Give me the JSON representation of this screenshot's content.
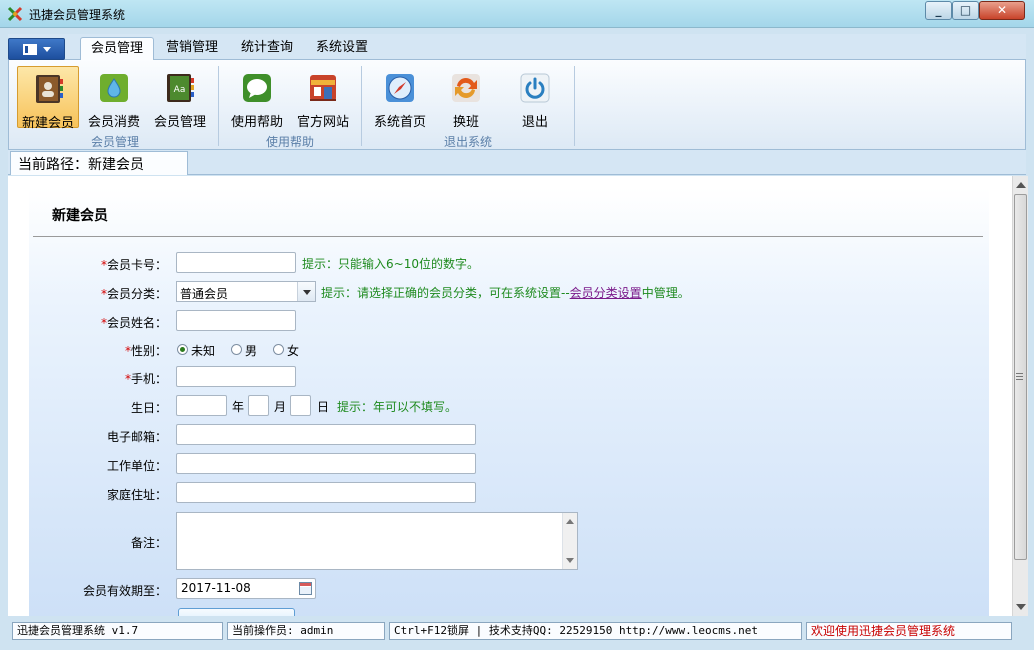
{
  "window": {
    "title": "迅捷会员管理系统"
  },
  "tabs": [
    {
      "label": "会员管理",
      "active": true
    },
    {
      "label": "营销管理",
      "active": false
    },
    {
      "label": "统计查询",
      "active": false
    },
    {
      "label": "系统设置",
      "active": false
    }
  ],
  "ribbon": {
    "groups": [
      {
        "label": "会员管理",
        "buttons": [
          {
            "label": "新建会员",
            "icon": "address-book-icon",
            "active": true
          },
          {
            "label": "会员消费",
            "icon": "water-drop-icon",
            "active": false
          },
          {
            "label": "会员管理",
            "icon": "book-icon",
            "active": false
          }
        ]
      },
      {
        "label": "使用帮助",
        "buttons": [
          {
            "label": "使用帮助",
            "icon": "chat-bubble-icon",
            "active": false
          },
          {
            "label": "官方网站",
            "icon": "storefront-icon",
            "active": false
          }
        ]
      },
      {
        "label": "退出系统",
        "buttons": [
          {
            "label": "系统首页",
            "icon": "compass-icon",
            "active": false
          },
          {
            "label": "换班",
            "icon": "swap-icon",
            "active": false
          },
          {
            "label": "退出",
            "icon": "power-icon",
            "active": false
          }
        ]
      }
    ]
  },
  "breadcrumb": {
    "text": "当前路径：新建会员"
  },
  "form": {
    "title": "新建会员",
    "card_no": {
      "label": "会员卡号：",
      "required": true,
      "value": "",
      "hint": "提示：只能输入6~10位的数字。"
    },
    "category": {
      "label": "会员分类：",
      "required": true,
      "value": "普通会员",
      "hint_before": "提示：请选择正确的会员分类，可在系统设置--",
      "hint_link": "会员分类设置",
      "hint_after": "中管理。"
    },
    "name": {
      "label": "会员姓名：",
      "required": true,
      "value": ""
    },
    "gender": {
      "label": "性别：",
      "required": true,
      "options": [
        "未知",
        "男",
        "女"
      ],
      "selected": "未知"
    },
    "mobile": {
      "label": "手机：",
      "required": true,
      "value": ""
    },
    "birthday": {
      "label": "生日：",
      "year_unit": "年",
      "month_unit": "月",
      "day_unit": "日",
      "hint": "提示：年可以不填写。"
    },
    "email": {
      "label": "电子邮箱：",
      "value": ""
    },
    "company": {
      "label": "工作单位：",
      "value": ""
    },
    "address": {
      "label": "家庭住址：",
      "value": ""
    },
    "remark": {
      "label": "备注：",
      "value": ""
    },
    "expiry": {
      "label": "会员有效期至：",
      "value": "2017-11-08"
    }
  },
  "statusbar": {
    "version": "迅捷会员管理系统 v1.7",
    "operator": "当前操作员: admin",
    "support": "Ctrl+F12锁屏 | 技术支持QQ:  22529150        http://www.leocms.net",
    "welcome": "欢迎使用迅捷会员管理系统"
  },
  "colors": {
    "accent": "#1d4f9e",
    "hint_green": "#1e8a1e",
    "required_red": "#d40000",
    "status_red": "#c80000",
    "active_button": "#f7c35b"
  }
}
